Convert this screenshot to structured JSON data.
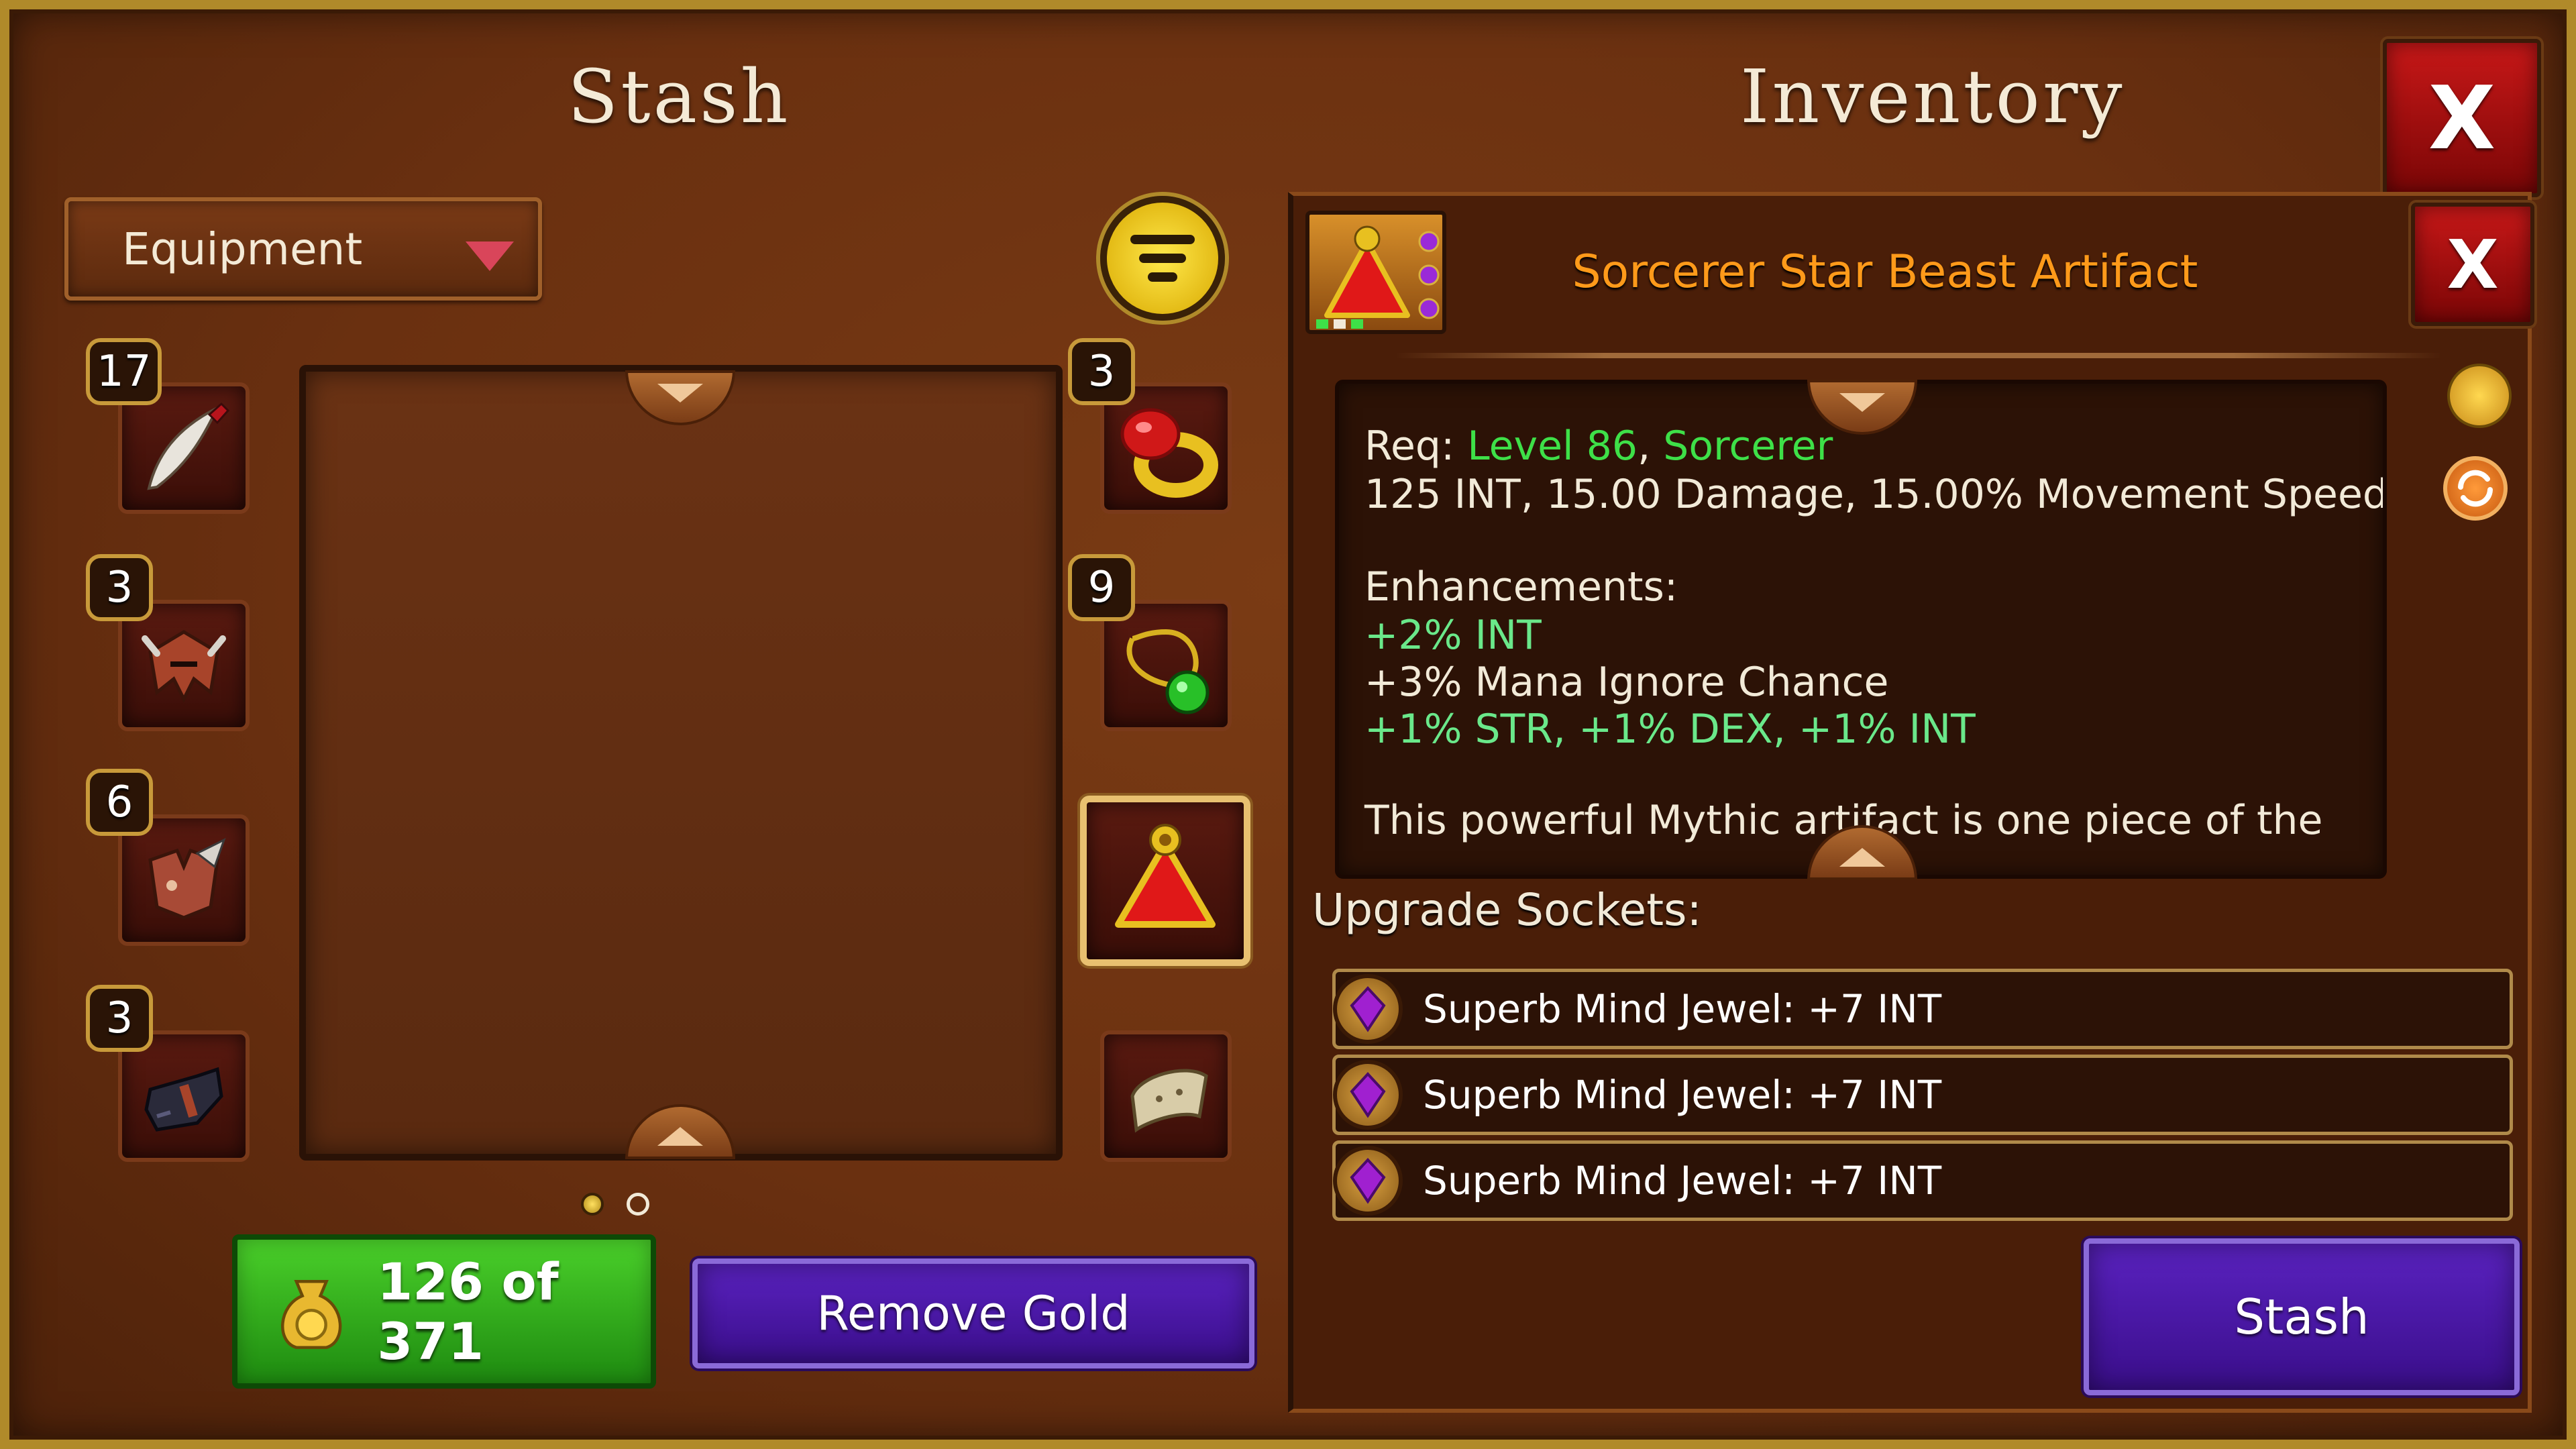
{
  "stash": {
    "title": "Stash",
    "category_dropdown": "Equipment",
    "gold_counter": "126 of 371",
    "remove_gold_label": "Remove Gold",
    "page_indicator": {
      "current": 1,
      "total": 2
    },
    "left_slots": [
      {
        "count": "17",
        "item": "dagger"
      },
      {
        "count": "3",
        "item": "helmet"
      },
      {
        "count": "6",
        "item": "armor"
      },
      {
        "count": "3",
        "item": "boots"
      }
    ],
    "right_slots": [
      {
        "count": "3",
        "item": "ring"
      },
      {
        "count": "9",
        "item": "necklace"
      },
      {
        "count": "",
        "item": "artifact",
        "selected": true
      },
      {
        "count": "",
        "item": "bracer"
      }
    ]
  },
  "inventory": {
    "title": "Inventory",
    "close_label": "X"
  },
  "item_detail": {
    "close_label": "X",
    "name": "Sorcerer Star Beast Artifact",
    "req_label": "Req:",
    "req_level": "Level 86",
    "req_sep": ",",
    "req_class": "Sorcerer",
    "stats_line": "125 INT, 15.00 Damage, 15.00% Movement Speed",
    "enhancements_label": "Enhancements:",
    "enhancements": [
      {
        "text": "+2% INT",
        "color": "#6ae88a"
      },
      {
        "text": "+3% Mana Ignore Chance",
        "color": "#f2ead8"
      },
      {
        "text": "+1% STR, +1% DEX, +1% INT",
        "color": "#6ae88a"
      }
    ],
    "description": "This powerful Mythic artifact is one piece of the",
    "sockets_label": "Upgrade Sockets:",
    "sockets": [
      {
        "text": "Superb Mind Jewel: +7 INT"
      },
      {
        "text": "Superb Mind Jewel: +7 INT"
      },
      {
        "text": "Superb Mind Jewel: +7 INT"
      }
    ],
    "stash_button": "Stash"
  },
  "colors": {
    "item_name": "#ff9a1a",
    "requirement": "#3ee048",
    "gold_button": "#2aa818",
    "purple_button": "#4a18a8",
    "close_button": "#c81818"
  }
}
